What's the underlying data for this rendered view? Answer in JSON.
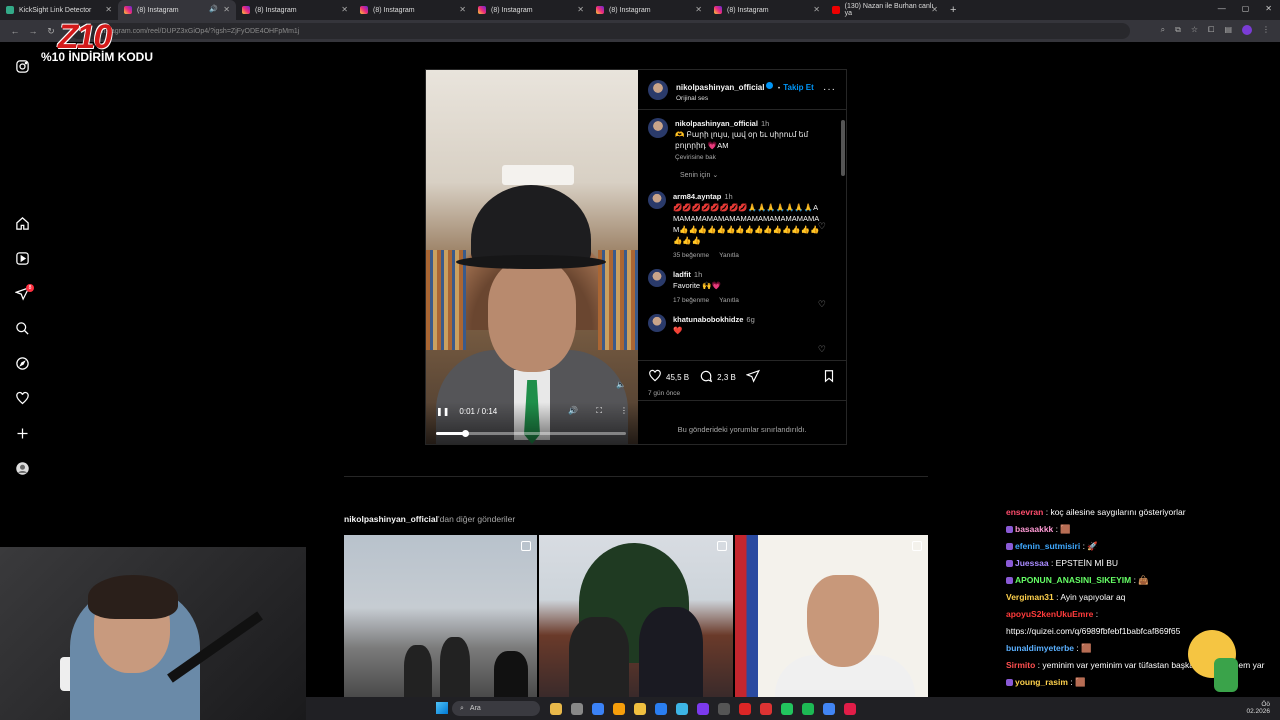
{
  "browser": {
    "tabs": [
      {
        "label": "KickSight Link Detector",
        "icon": "kicksight-icon",
        "active": false
      },
      {
        "label": "(8) Instagram",
        "icon": "instagram-icon",
        "active": true
      },
      {
        "label": "(8) Instagram",
        "icon": "instagram-icon",
        "active": false
      },
      {
        "label": "(8) Instagram",
        "icon": "instagram-icon",
        "active": false
      },
      {
        "label": "(8) Instagram",
        "icon": "instagram-icon",
        "active": false
      },
      {
        "label": "(8) Instagram",
        "icon": "instagram-icon",
        "active": false
      },
      {
        "label": "(8) Instagram",
        "icon": "instagram-icon",
        "active": false
      },
      {
        "label": "(130) Nazan ile Burhan canlı ya",
        "icon": "youtube-icon",
        "active": false
      }
    ],
    "url": "instagram.com/reel/DUPZ3xGiOp4/?igsh=ZjFyODE4OHFpMm1j"
  },
  "overlay": {
    "logo_text": "Z10",
    "promo": "%10 İNDİRİM KODU"
  },
  "sidebar": {
    "notifications_badge": "8",
    "items": [
      "home-icon",
      "reels-icon",
      "messages-icon",
      "search-icon",
      "explore-icon",
      "notifications-icon",
      "create-icon",
      "profile-icon"
    ]
  },
  "post": {
    "username": "nikolpashinyan_official",
    "follow_label": "Takip Et",
    "audio": "Orijinal ses",
    "caption_time": "1h",
    "caption": "🫶 Բարի լույս, լավ օր եւ սիրում եմ բոլորիդ 💗AM",
    "translate": "Çevirisine bak",
    "sort_label": "Senin için",
    "video_time": "0:01 / 0:14",
    "video_progress": 0.15,
    "likes": "45,5 B",
    "comments_count": "2,3 B",
    "posted": "7 gün önce",
    "limited_notice": "Bu gönderideki yorumlar sınırlandırıldı."
  },
  "comments": [
    {
      "user": "arm84.ayntap",
      "time": "1h",
      "text": "💋💋💋💋💋💋💋💋🙏🙏🙏🙏🙏🙏🙏AMAMAMAMAMAMAMAMAMAMAMAMAMAM👍👍👍👍👍👍👍👍👍👍👍👍👍👍👍👍👍👍",
      "likes": "35 beğenme",
      "reply": "Yanıtla"
    },
    {
      "user": "ladfit",
      "time": "1h",
      "text": "Favorite 🙌💗",
      "likes": "17 beğenme",
      "reply": "Yanıtla"
    },
    {
      "user": "khatunabobokhidze",
      "time": "6g",
      "text": "❤️",
      "likes": "",
      "reply": ""
    }
  ],
  "more_posts": {
    "owner": "nikolpashinyan_official",
    "suffix": "'dan diğer gönderiler"
  },
  "chat": [
    {
      "user": "ensevran",
      "color": "#ff4d6d",
      "msg": ": koç ailesine saygılarını gösteriyorlar",
      "badge": false
    },
    {
      "user": "basaakkk",
      "color": "#ff9ad5",
      "msg": ": 🟫",
      "badge": true
    },
    {
      "user": "efenin_sutmisiri",
      "color": "#3fa9ff",
      "msg": ": 🚀",
      "badge": true
    },
    {
      "user": "Juessaa",
      "color": "#a98bff",
      "msg": ": EPSTEİN Mİ BU",
      "badge": true
    },
    {
      "user": "APONUN_ANASINI_SIKEYIM",
      "color": "#66ff66",
      "msg": ": 👜",
      "badge": true
    },
    {
      "user": "Vergiman31",
      "color": "#ffd24d",
      "msg": ": Ayin yapıyolar aq",
      "badge": false
    },
    {
      "user": "apoyuS2kenUkuEmre",
      "color": "#ff3b3b",
      "msg": ":",
      "badge": false
    },
    {
      "user": "",
      "color": "#ffffff",
      "msg": "https://quizei.com/q/6989fbfebf1babfcaf869f65",
      "badge": false
    },
    {
      "user": "bunaldimyeterbe",
      "color": "#5ab0ff",
      "msg": ": 🟫",
      "badge": false
    },
    {
      "user": "Sirmito",
      "color": "#ff5050",
      "msg": ": yeminim var yeminim var tüfastan başka araca binmem yar",
      "badge": false
    },
    {
      "user": "young_rasim",
      "color": "#ffd24d",
      "msg": ": 🟫",
      "badge": true
    }
  ],
  "taskbar": {
    "search_placeholder": "Ara",
    "time": "Öö",
    "date": "02.2026"
  },
  "colors": {
    "accent": "#0095f6",
    "background": "#000000",
    "badge": "#ff3040"
  }
}
